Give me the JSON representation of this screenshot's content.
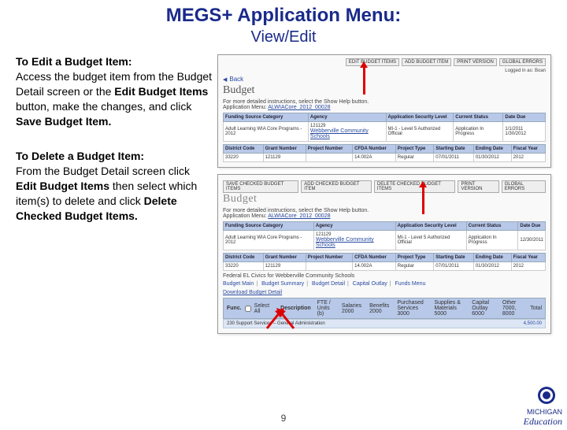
{
  "page": {
    "title": "MEGS+ Application Menu:",
    "subtitle": "View/Edit",
    "footer_page": "9",
    "logo_text": "MICHIGAN",
    "logo_sub": "Education"
  },
  "left": {
    "edit_head": "To Edit a Budget Item:",
    "edit_body_1": "Access the budget item from the Budget Detail screen or the ",
    "edit_body_bold": "Edit Budget Items",
    "edit_body_2": " button, make the changes, and click ",
    "edit_body_bold2": "Save Budget Item.",
    "delete_head": "To Delete a Budget Item:",
    "delete_body_1": "From the Budget Detail screen click ",
    "delete_body_bold": "Edit Budget Items",
    "delete_body_2": " then select which item(s) to delete and click ",
    "delete_body_bold2": "Delete Checked Budget Items."
  },
  "shot1": {
    "buttons": [
      "EDIT BUDGET ITEMS",
      "ADD BUDGET ITEM",
      "PRINT VERSION",
      "GLOBAL ERRORS"
    ],
    "logged": "Logged in as: Boan",
    "back": "Back",
    "heading": "Budget",
    "help": "For more detailed instructions, select the Show Help button.",
    "menu_label": "Application Menu:",
    "menu_link": "ALWIACore_2012_00028",
    "hdr1": [
      "Funding Source Category",
      "Agency",
      "Application Security Level",
      "Current Status",
      "Date Due"
    ],
    "row1": [
      "Adult Learning WIA Core Programs - 2012",
      "121129",
      "Webberville Community Schools",
      "MI-1 - Level 5 Authorized Official",
      "Application In Progress",
      "1/1/2011 1/30/2012"
    ],
    "hdr2": [
      "District Code",
      "Grant Number",
      "Project Number",
      "CFDA Number",
      "Project Type",
      "Starting Date",
      "Ending Date",
      "Fiscal Year"
    ],
    "row2": [
      "33220",
      "121129",
      "",
      "14.002A",
      "Regular",
      "07/01/2011",
      "01/30/2012",
      "2012"
    ]
  },
  "shot2": {
    "buttons": [
      "SAVE CHECKED BUDGET ITEMS",
      "ADD CHECKED BUDGET ITEM",
      "DELETE CHECKED BUDGET ITEMS",
      "PRINT VERSION",
      "GLOBAL ERRORS"
    ],
    "heading": "Budget",
    "help": "For more detailed instructions, select the Show Help button.",
    "menu_label": "Application Menu:",
    "menu_link": "ALWIACore_2012_00028",
    "hdr1": [
      "Funding Source Category",
      "Agency",
      "Application Security Level",
      "Current Status",
      "Date Due"
    ],
    "row1": [
      "Adult Learning WIA Core Programs - 2012",
      "121129",
      "Webberville Community Schools",
      "MI-1 - Level 5 Authorized Official",
      "Application In Progress",
      "12/30/2011"
    ],
    "hdr2": [
      "District Code",
      "Grant Number",
      "Project Number",
      "CFDA Number",
      "Project Type",
      "Starting Date",
      "Ending Date",
      "Fiscal Year"
    ],
    "row2": [
      "33220",
      "121129",
      "",
      "14.002A",
      "Regular",
      "07/01/2011",
      "01/30/2012",
      "2012"
    ],
    "federal": "Federal EL Civics for Webberville Community Schools",
    "tabs": [
      "Budget Main",
      "Budget Summary",
      "Budget Detail",
      "Capital Outlay",
      "Funds Menu"
    ],
    "download": "Download Budget Detail",
    "func_label": "Func.",
    "selectall": "Select All",
    "desc": "Description",
    "cols": [
      "FTE / Units (b)",
      "Salaries 2000",
      "Benefits 2000",
      "Purchased Services 3000",
      "Supplies & Materials 5000",
      "Capital Outlay 6000",
      "Other 7000, 8000",
      "Total"
    ],
    "valrow": "230   Support Services – General Administration",
    "valnums": "4,500.00"
  }
}
